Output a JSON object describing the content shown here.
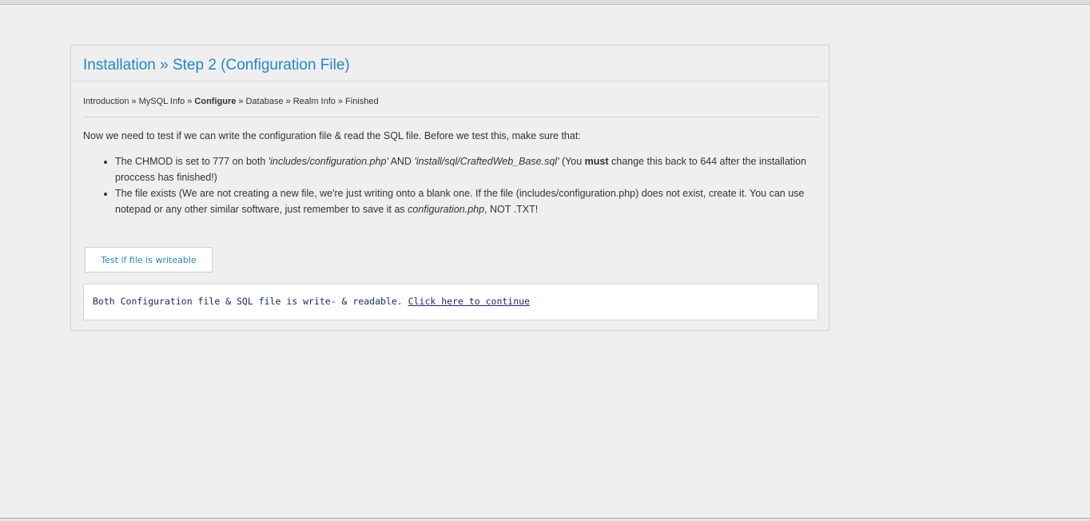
{
  "panel": {
    "title": "Installation » Step 2 (Configuration File)"
  },
  "breadcrumb": {
    "separator": "»",
    "items": [
      "Introduction",
      "MySQL Info",
      "Configure",
      "Database",
      "Realm Info",
      "Finished"
    ],
    "current_index": 2
  },
  "intro": "Now we need to test if we can write the configuration file & read the SQL file. Before we test this, make sure that:",
  "requirements": {
    "item1": {
      "p1": "The CHMOD is set to 777 on both ",
      "file1": "'includes/configuration.php'",
      "p2": " AND ",
      "file2": "'install/sql/CraftedWeb_Base.sql'",
      "p3": " (You ",
      "emphasis": "must",
      "p4": " change this back to 644 after the installation proccess has finished!)"
    },
    "item2": {
      "p1": "The file exists (We are not creating a new file, we're just writing onto a blank one. If the file (includes/configuration.php) does not exist, create it. You can use notepad or any other similar software, just remember to save it as ",
      "filename": "configuration.php",
      "p2": ", NOT .TXT!"
    }
  },
  "test_button": {
    "label": "Test if file is writeable"
  },
  "result": {
    "message": "Both Configuration file & SQL file is write- & readable.",
    "link_label": "Click here to continue"
  }
}
